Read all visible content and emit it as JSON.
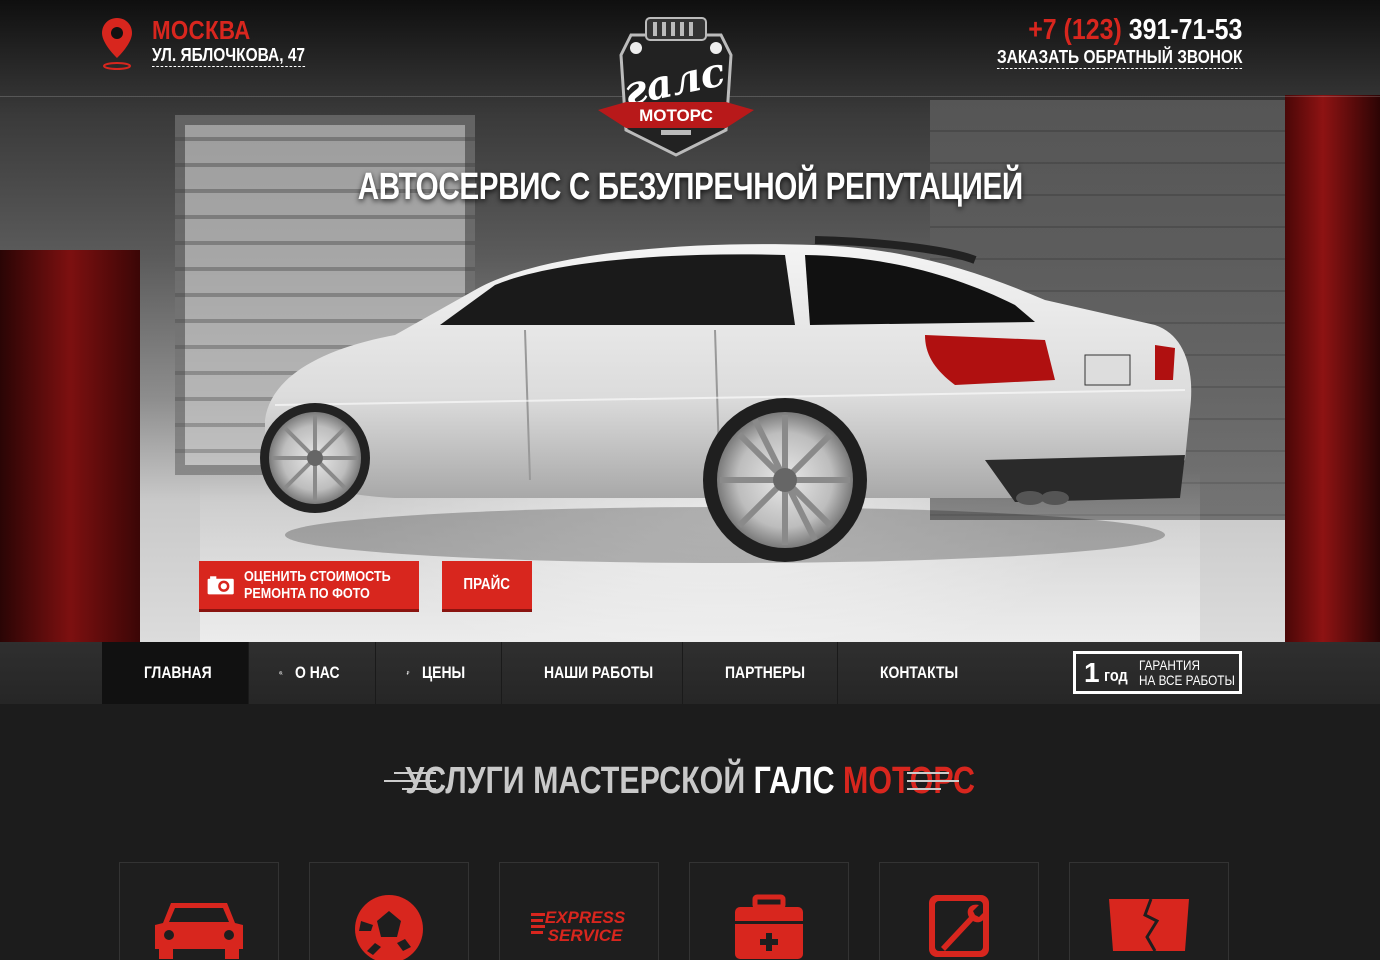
{
  "header": {
    "city": "МОСКВА",
    "address": "УЛ. ЯБЛОЧКОВА, 47",
    "phone_code": "+7 (123)",
    "phone_number": "391-71-53",
    "callback_label": "ЗАКАЗАТЬ ОБРАТНЫЙ ЗВОНОК"
  },
  "logo": {
    "word_top": "галс",
    "word_bottom": "МОТОРС"
  },
  "hero": {
    "headline": "АВТОСЕРВИС С БЕЗУПРЕЧНОЙ РЕПУТАЦИЕЙ",
    "photo_button_line1": "ОЦЕНИТЬ СТОИМОСТЬ",
    "photo_button_line2": "РЕМОНТА ПО ФОТО",
    "price_button": "ПРАЙС"
  },
  "nav": {
    "items": [
      {
        "label": "ГЛАВНАЯ",
        "icon": "home-icon"
      },
      {
        "label": "О НАС",
        "icon": "wheel-icon"
      },
      {
        "label": "ЦЕНЫ",
        "icon": "ruble-icon"
      },
      {
        "label": "НАШИ РАБОТЫ",
        "icon": "mechanic-icon"
      },
      {
        "label": "ПАРТНЕРЫ",
        "icon": "handshake-icon"
      },
      {
        "label": "КОНТАКТЫ",
        "icon": "location-icon"
      }
    ],
    "active_index": 0
  },
  "warranty": {
    "years": "1",
    "unit": "год",
    "line1": "ГАРАНТИЯ",
    "line2": "НА ВСЕ РАБОТЫ"
  },
  "services": {
    "title_part1": "УСЛУГИ МАСТЕРСКОЙ ",
    "title_part2": "ГАЛС ",
    "title_part3": "МОТОРС",
    "cards": [
      {
        "icon": "car-icon"
      },
      {
        "icon": "brake-disc-icon"
      },
      {
        "icon": "express-service-icon",
        "line1": "EXPRESS",
        "line2": "SERVICE"
      },
      {
        "icon": "first-aid-kit-icon"
      },
      {
        "icon": "wrench-icon"
      },
      {
        "icon": "glass-repair-icon"
      }
    ]
  },
  "colors": {
    "accent": "#d8261e",
    "dark": "#1c1c1c",
    "nav": "#2b2b2b"
  }
}
